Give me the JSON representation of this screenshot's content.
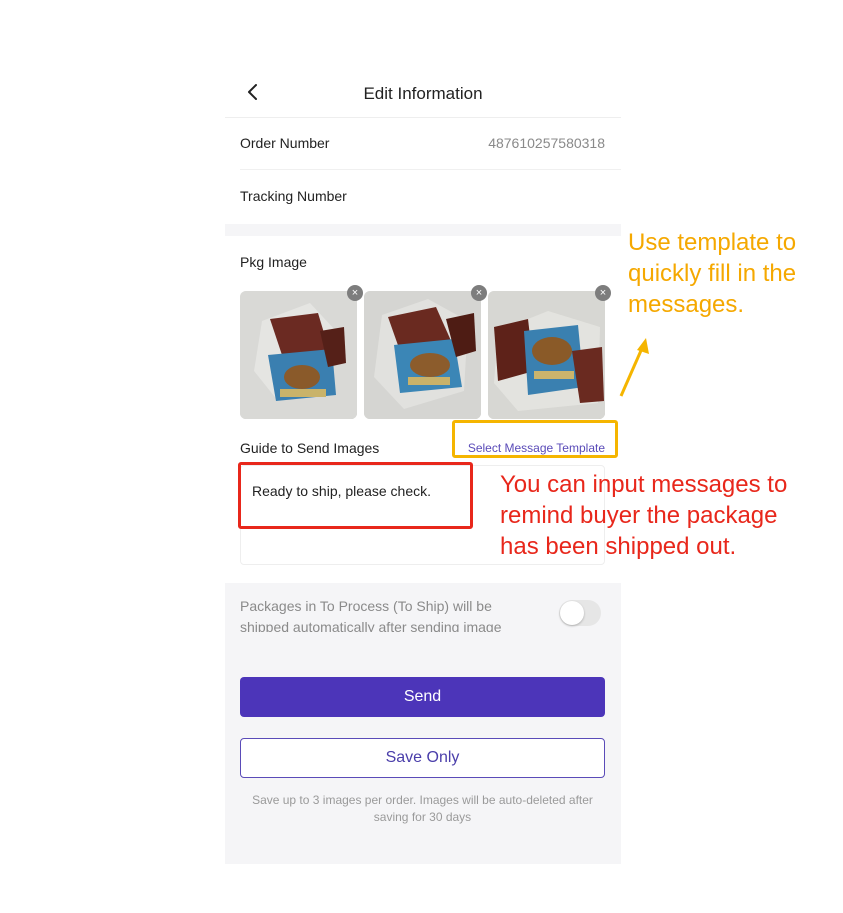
{
  "header": {
    "title": "Edit Information",
    "back_icon": "chevron-left-icon"
  },
  "order": {
    "order_number_label": "Order Number",
    "order_number_value": "487610257580318",
    "tracking_number_label": "Tracking Number"
  },
  "pkg": {
    "label": "Pkg Image",
    "images": [
      {
        "remove_symbol": "×"
      },
      {
        "remove_symbol": "×"
      },
      {
        "remove_symbol": "×"
      }
    ]
  },
  "guide": {
    "label": "Guide to Send Images",
    "template_link": "Select Message Template",
    "message": "Ready to ship, please check."
  },
  "auto_ship": {
    "text": "Packages in To Process (To Ship) will be shipped automatically after sending image",
    "enabled": false
  },
  "actions": {
    "send_label": "Send",
    "save_label": "Save Only"
  },
  "footnote": "Save up to 3 images per order. Images will be auto-deleted after saving for 30 days",
  "annotations": {
    "orange_text": "Use template to quickly fill in the messages.",
    "red_text": "You can input messages to remind buyer the package has been shipped out.",
    "orange_color": "#f5b500",
    "red_color": "#e8271b"
  },
  "colors": {
    "primary": "#4c35b9",
    "link": "#5a4bb8"
  }
}
